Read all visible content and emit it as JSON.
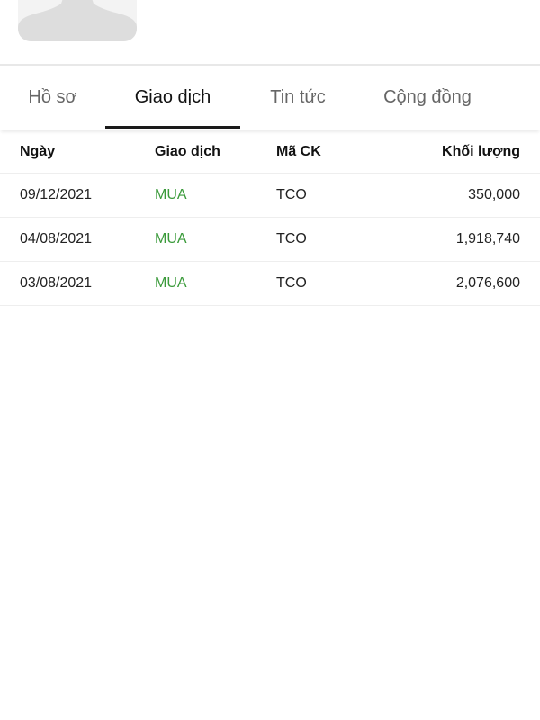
{
  "colors": {
    "buy": "#3a9a3a",
    "active_tab_underline": "#1a1a1a",
    "inactive_tab_text": "#666666"
  },
  "tabs": [
    {
      "label": "Hồ sơ",
      "active": false
    },
    {
      "label": "Giao dịch",
      "active": true
    },
    {
      "label": "Tin tức",
      "active": false
    },
    {
      "label": "Cộng đồng",
      "active": false
    }
  ],
  "table": {
    "headers": {
      "date": "Ngày",
      "type": "Giao dịch",
      "code": "Mã CK",
      "volume": "Khối lượng"
    },
    "rows": [
      {
        "date": "09/12/2021",
        "type": "MUA",
        "code": "TCO",
        "volume": "350,000"
      },
      {
        "date": "04/08/2021",
        "type": "MUA",
        "code": "TCO",
        "volume": "1,918,740"
      },
      {
        "date": "03/08/2021",
        "type": "MUA",
        "code": "TCO",
        "volume": "2,076,600"
      }
    ]
  }
}
